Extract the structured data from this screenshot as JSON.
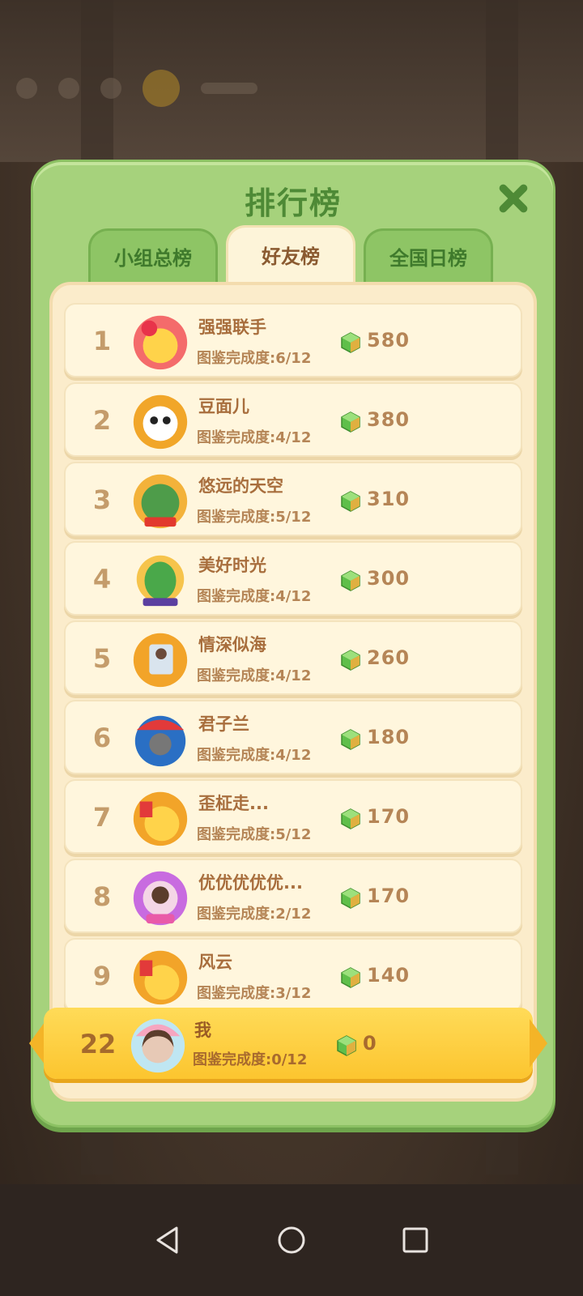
{
  "panel": {
    "title": "排行榜",
    "tabs": [
      {
        "label": "小组总榜",
        "active": false
      },
      {
        "label": "好友榜",
        "active": true
      },
      {
        "label": "全国日榜",
        "active": false
      }
    ]
  },
  "colors": {
    "panel_green": "#a6d27c",
    "title_green": "#4e8a36",
    "list_cream": "#fbeccb",
    "me_yellow": "#fcc52f",
    "gem_green": "#5fbf4a"
  },
  "rows": [
    {
      "rank": "1",
      "name": "强强联手",
      "progress": "图鉴完成度:6/12",
      "score": "580",
      "avatar": "cat-chick-avatar"
    },
    {
      "rank": "2",
      "name": "豆面儿",
      "progress": "图鉴完成度:4/12",
      "score": "380",
      "avatar": "panda-avatar"
    },
    {
      "rank": "3",
      "name": "悠远的天空",
      "progress": "图鉴完成度:5/12",
      "score": "310",
      "avatar": "landscape-avatar"
    },
    {
      "rank": "4",
      "name": "美好时光",
      "progress": "图鉴完成度:4/12",
      "score": "300",
      "avatar": "watermelon-avatar"
    },
    {
      "rank": "5",
      "name": "情深似海",
      "progress": "图鉴完成度:4/12",
      "score": "260",
      "avatar": "photo-avatar"
    },
    {
      "rank": "6",
      "name": "君子兰",
      "progress": "图鉴完成度:4/12",
      "score": "180",
      "avatar": "carousel-avatar"
    },
    {
      "rank": "7",
      "name": "歪柾走...",
      "progress": "图鉴完成度:5/12",
      "score": "170",
      "avatar": "chick-avatar"
    },
    {
      "rank": "8",
      "name": "优优优优优...",
      "progress": "图鉴完成度:2/12",
      "score": "170",
      "avatar": "girl-avatar"
    },
    {
      "rank": "9",
      "name": "风云",
      "progress": "图鉴完成度:3/12",
      "score": "140",
      "avatar": "chick-avatar"
    }
  ],
  "me": {
    "rank": "22",
    "name": "我",
    "progress": "图鉴完成度:0/12",
    "score": "0",
    "avatar": "self-avatar"
  },
  "navbar": {
    "icons": [
      "back-icon",
      "home-icon",
      "recents-icon"
    ]
  }
}
